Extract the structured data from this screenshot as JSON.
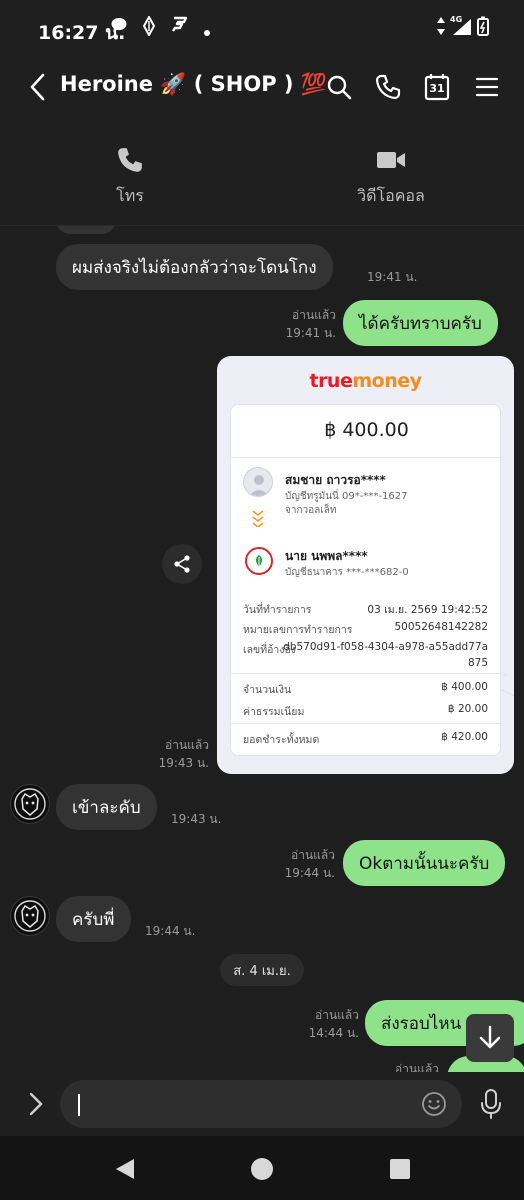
{
  "status_bar": {
    "time": "16:27 น.",
    "network": "4G"
  },
  "header": {
    "title": "Heroine 🚀 ( SHOP ) 💯",
    "calendar_day": "31",
    "icons": [
      "back-arrow-icon",
      "search-icon",
      "phone-icon",
      "calendar-icon",
      "menu-icon"
    ]
  },
  "call_options": {
    "voice_label": "โทร",
    "video_label": "วิดีโอคอล"
  },
  "messages": {
    "m1": {
      "text": "ผมส่งจริงไม่ต้องกลัวว่าจะโดนโกง",
      "time": "19:41 น."
    },
    "m2": {
      "text": "ได้ครับทราบครับ",
      "read": "อ่านแล้ว",
      "time": "19:41 น."
    },
    "m3": {
      "read": "อ่านแล้ว",
      "time": "19:43 น."
    },
    "m4": {
      "text": "เข้าละคับ",
      "time": "19:43 น."
    },
    "m5": {
      "text": "Okตามนั้นนะครับ",
      "read": "อ่านแล้ว",
      "time": "19:44 น."
    },
    "m6": {
      "text": "ครับพี่",
      "time": "19:44 น."
    },
    "date_chip": "ส. 4 เม.ย.",
    "m7": {
      "text": "ส่งรอบไหน",
      "read": "อ่านแล้ว",
      "time": "14:44 น."
    },
    "m8": {
      "read": "อ่านแล้ว"
    }
  },
  "receipt": {
    "logo_true": "true",
    "logo_money": "money",
    "amount": "฿ 400.00",
    "sender_name": "สมชาย ถาวรอ****",
    "sender_account": "บัญชีทรูมันนี่ 09*-***-1627",
    "sender_source": "จากวอลเล็ท",
    "receiver_name": "นาย นพพล****",
    "receiver_account": "บัญชีธนาคาร ***-***682-0",
    "date_label": "วันที่ทำรายการ",
    "date_value": "03 เม.ย. 2569 19:42:52",
    "txn_label": "หมายเลขการทำรายการ",
    "txn_value": "50052648142282",
    "ref_label": "เลขที่อ้างอิง",
    "ref_value_1": "db570d91-f058-4304-a978-a55add77a",
    "ref_value_2": "875",
    "amt_label": "จำนวนเงิน",
    "amt_value": "฿ 400.00",
    "fee_label": "ค่าธรรมเนียม",
    "fee_value": "฿ 20.00",
    "total_label": "ยอดชำระทั้งหมด",
    "total_value": "฿ 420.00"
  },
  "input": {
    "placeholder": ""
  },
  "colors": {
    "outgoing_bubble": "#8ee38a",
    "incoming_bubble": "#333333",
    "background": "#1e1e1e"
  }
}
